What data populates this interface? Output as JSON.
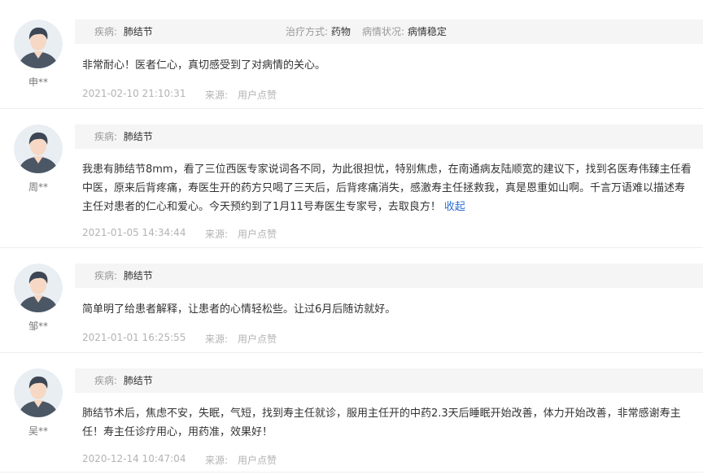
{
  "labels": {
    "disease": "疾病:",
    "treatment": "治疗方式:",
    "condition": "病情状况:",
    "source": "来源:",
    "collapse": "收起"
  },
  "reviews": [
    {
      "user": "申**",
      "disease": "肺结节",
      "treatment": "药物",
      "condition": "病情稳定",
      "text": "非常耐心！医者仁心，真切感受到了对病情的关心。",
      "date": "2021-02-10 21:10:31",
      "source": "用户点赞"
    },
    {
      "user": "周**",
      "disease": "肺结节",
      "text": "我患有肺结节8mm，看了三位西医专家说词各不同，为此很担忧，特别焦虑，在南通病友陆顺宽的建议下，找到名医寿伟臻主任看中医，原来后背疼痛，寿医生开的药方只喝了三天后，后背疼痛消失，感激寿主任拯救我，真是恩重如山啊。千言万语难以描述寿主任对患者的仁心和爱心。今天预约到了1月11号寿医生专家号，去取良方！",
      "date": "2021-01-05 14:34:44",
      "source": "用户点赞"
    },
    {
      "user": "邹**",
      "disease": "肺结节",
      "text": "简单明了给患者解释，让患者的心情轻松些。让过6月后随访就好。",
      "date": "2021-01-01 16:25:55",
      "source": "用户点赞"
    },
    {
      "user": "吴**",
      "disease": "肺结节",
      "text": "肺结节术后，焦虑不安，失眠，气短，找到寿主任就诊，服用主任开的中药2.3天后睡眠开始改善，体力开始改善，非常感谢寿主任！寿主任诊疗用心，用药准，效果好！",
      "date": "2020-12-14 10:47:04",
      "source": "用户点赞"
    }
  ]
}
